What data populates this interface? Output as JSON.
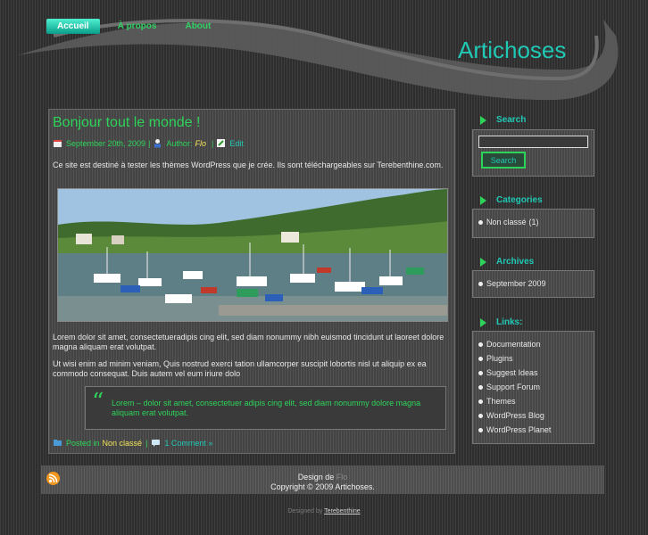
{
  "nav": [
    {
      "label": "Accueil",
      "active": true
    },
    {
      "label": "À propos",
      "active": false
    },
    {
      "label": "About",
      "active": false
    }
  ],
  "site_title": "Artichoses",
  "post": {
    "title": "Bonjour tout le monde !",
    "date": "September 20th, 2009",
    "author_label": "Author:",
    "author": "Flo",
    "edit": "Edit",
    "p1": "Ce site est destiné à tester les thèmes WordPress que je crée. Ils sont téléchargeables sur Terebenthine.com.",
    "p2": "Lorem dolor sit amet, consectetueradipis cing elit, sed diam nonummy nibh euismod tincidunt ut laoreet dolore magna aliquam erat volutpat.",
    "p3": "Ut wisi enim ad minim veniam, Quis nostrud exerci tation ullamcorper suscipit lobortis nisl ut aliquip ex ea commodo consequat. Duis autem vel eum iriure dolo",
    "quote": "Lorem – dolor sit amet, consectetuer adipis cing elit, sed diam nonummy dolore magna aliquam erat volutpat.",
    "posted_in": "Posted in",
    "category": "Non classé",
    "comments": "1 Comment »"
  },
  "sidebar": {
    "search_title": "Search",
    "search_button": "Search",
    "categories_title": "Categories",
    "categories": [
      {
        "name": "Non classé",
        "count": "(1)"
      }
    ],
    "archives_title": "Archives",
    "archives": [
      "September 2009"
    ],
    "links_title": "Links:",
    "links": [
      "Documentation",
      "Plugins",
      "Suggest Ideas",
      "Support Forum",
      "Themes",
      "WordPress Blog",
      "WordPress Planet"
    ]
  },
  "footer": {
    "design_by": "Design de",
    "designer": "Flo",
    "copyright": "Copyright © 2009 Artichoses."
  },
  "credit": {
    "designed_by": "Designed by",
    "link": "Terebenthine"
  },
  "colors": {
    "accent": "#20c9b5",
    "green": "#2ed45a",
    "yellow": "#f2e35a"
  }
}
